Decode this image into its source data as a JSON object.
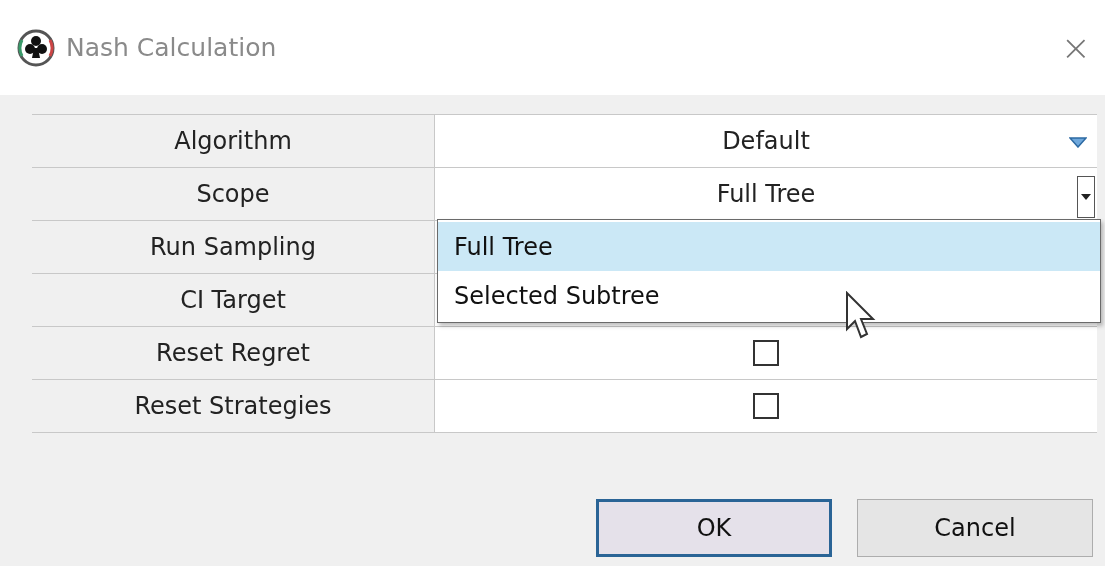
{
  "window": {
    "title": "Nash Calculation",
    "close": "×"
  },
  "properties": [
    {
      "label": "Algorithm",
      "kind": "dropdown",
      "value": "Default",
      "open": false
    },
    {
      "label": "Scope",
      "kind": "dropdown",
      "value": "Full Tree",
      "open": true
    },
    {
      "label": "Run Sampling"
    },
    {
      "label": "CI Target"
    },
    {
      "label": "Reset Regret",
      "kind": "checkbox",
      "checked": false
    },
    {
      "label": "Reset Strategies",
      "kind": "checkbox",
      "checked": false
    }
  ],
  "dropdown_list": [
    {
      "label": "Full Tree",
      "selected": true
    },
    {
      "label": "Selected Subtree",
      "selected": false
    }
  ],
  "buttons": [
    {
      "label": "OK",
      "default": true
    },
    {
      "label": "Cancel",
      "default": false
    }
  ]
}
